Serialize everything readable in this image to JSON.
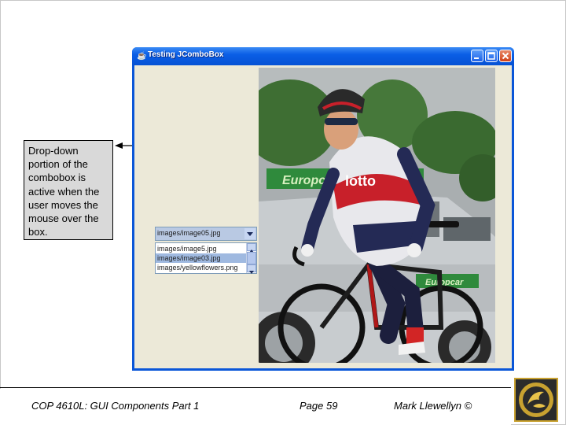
{
  "callout": {
    "text": "Drop-down\nportion of the\ncombobox is\nactive when the\nuser moves the\nmouse over the\nbox."
  },
  "window": {
    "title": "Testing JComboBox",
    "icon": "java-cup-icon",
    "buttons": [
      "minimize-icon",
      "maximize-icon",
      "close-icon"
    ]
  },
  "combobox": {
    "selected_value": "images/image05.jpg",
    "options": [
      {
        "label": "images/image5.jpg",
        "selected": false
      },
      {
        "label": "images/image03.jpg",
        "selected": true
      },
      {
        "label": "images/yellowflowers.png",
        "selected": false
      }
    ]
  },
  "colors": {
    "titlebar": "#0a5ee6",
    "combo_selected_bg": "#b9c9e3",
    "callout_bg": "#d9d9d9"
  },
  "footer": {
    "course": "COP 4610L: GUI Components Part 1",
    "page": "Page 59",
    "author": "Mark Llewellyn ©"
  },
  "logo": {
    "icon": "ucf-pegasus-logo-icon"
  }
}
